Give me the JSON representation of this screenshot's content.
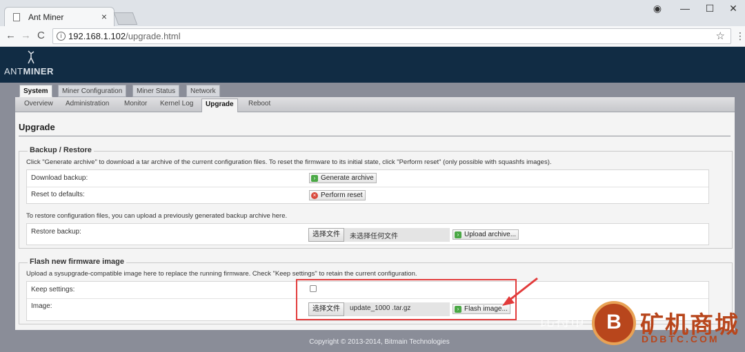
{
  "browser": {
    "tab_title": "Ant Miner",
    "tab_close": "×",
    "url_host": "192.168.1.102",
    "url_path": "/upgrade.html",
    "back": "←",
    "forward": "→",
    "reload": "C",
    "star": "☆",
    "menu": "⋮",
    "profile": "◉",
    "minimize": "—",
    "maximize": "☐",
    "close": "✕"
  },
  "app": {
    "logo_prefix": "ANT",
    "logo_suffix": "MINER",
    "main_tabs": [
      {
        "label": "System",
        "active": true
      },
      {
        "label": "Miner Configuration",
        "active": false
      },
      {
        "label": "Miner Status",
        "active": false
      },
      {
        "label": "Network",
        "active": false
      }
    ],
    "sub_tabs": [
      {
        "label": "Overview",
        "active": false
      },
      {
        "label": "Administration",
        "active": false
      },
      {
        "label": "Monitor",
        "active": false
      },
      {
        "label": "Kernel Log",
        "active": false
      },
      {
        "label": "Upgrade",
        "active": true
      },
      {
        "label": "Reboot",
        "active": false
      }
    ],
    "page_title": "Upgrade",
    "backup": {
      "legend": "Backup / Restore",
      "description": "Click \"Generate archive\" to download a tar archive of the current configuration files. To reset the firmware to its initial state, click \"Perform reset\" (only possible with squashfs images).",
      "download_label": "Download backup:",
      "generate_button": "Generate archive",
      "reset_label": "Reset to defaults:",
      "reset_button": "Perform reset",
      "restore_description": "To restore configuration files, you can upload a previously generated backup archive here.",
      "restore_label": "Restore backup:",
      "choose_file_button": "选择文件",
      "no_file_text": "未选择任何文件",
      "upload_button": "Upload archive..."
    },
    "flash": {
      "legend": "Flash new firmware image",
      "description": "Upload a sysupgrade-compatible image here to replace the running firmware. Check \"Keep settings\" to retain the current configuration.",
      "keep_label": "Keep settings:",
      "keep_checked": false,
      "image_label": "Image:",
      "choose_file_button": "选择文件",
      "file_name": "update_1000 .tar.gz",
      "flash_button": "Flash image..."
    },
    "footer": "Copyright © 2013-2014, Bitmain Technologies"
  },
  "watermark": {
    "left_text": "比特币",
    "circle_glyph": "B",
    "brand": "矿机商城",
    "domain": "DDBTC.COM"
  },
  "colors": {
    "header_bg": "#112c44",
    "body_bg": "#8a8d98",
    "highlight": "#e23b3b",
    "watermark": "#b8461c"
  }
}
